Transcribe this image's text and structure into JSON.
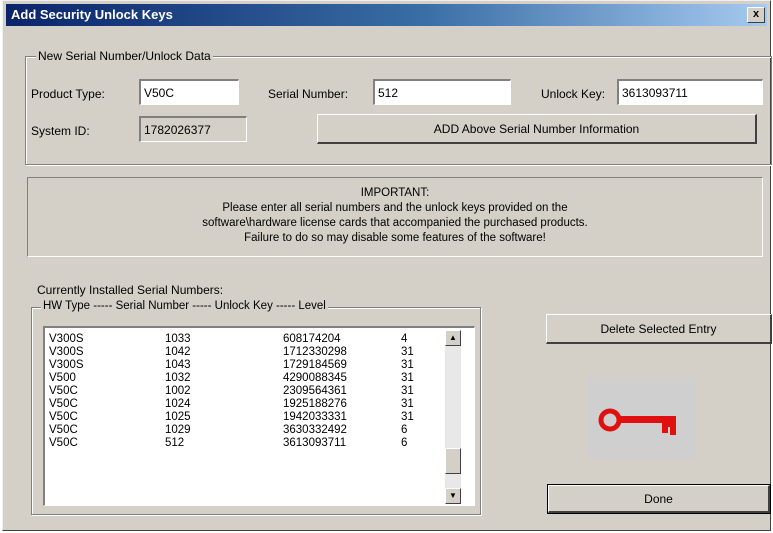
{
  "window": {
    "title": "Add Security Unlock Keys",
    "close_glyph": "x"
  },
  "serial_group": {
    "legend": "New Serial Number/Unlock Data",
    "product_type_label": "Product Type:",
    "product_type_value": "V50C",
    "serial_number_label": "Serial Number:",
    "serial_number_value": "512",
    "unlock_key_label": "Unlock Key:",
    "unlock_key_value": "3613093711",
    "system_id_label": "System ID:",
    "system_id_value": "1782026377",
    "add_button_label": "ADD Above Serial Number Information"
  },
  "important": {
    "heading": "IMPORTANT:",
    "line1": "Please enter all serial numbers and the unlock keys provided on the",
    "line2": "software\\hardware license cards that accompanied the purchased products.",
    "line3": "Failure to do so may disable some features of the software!"
  },
  "installed": {
    "label": "Currently Installed Serial Numbers:",
    "header": "HW Type ----- Serial Number ----- Unlock Key ----- Level",
    "rows": [
      {
        "hw_type": "V300S",
        "serial": "1033",
        "key": "608174204",
        "level": "4"
      },
      {
        "hw_type": "V300S",
        "serial": "1042",
        "key": "1712330298",
        "level": "31"
      },
      {
        "hw_type": "V300S",
        "serial": "1043",
        "key": "1729184569",
        "level": "31"
      },
      {
        "hw_type": "V500",
        "serial": "1032",
        "key": "4290088345",
        "level": "31"
      },
      {
        "hw_type": "V50C",
        "serial": "1002",
        "key": "2309564361",
        "level": "31"
      },
      {
        "hw_type": "V50C",
        "serial": "1024",
        "key": "1925188276",
        "level": "31"
      },
      {
        "hw_type": "V50C",
        "serial": "1025",
        "key": "1942033331",
        "level": "31"
      },
      {
        "hw_type": "V50C",
        "serial": "1029",
        "key": "3630332492",
        "level": "6"
      },
      {
        "hw_type": "V50C",
        "serial": "512",
        "key": "3613093711",
        "level": "6"
      }
    ]
  },
  "buttons": {
    "delete_label": "Delete Selected Entry",
    "done_label": "Done"
  },
  "icons": {
    "scroll_up": "▲",
    "scroll_down": "▼",
    "key_icon": "key-icon"
  },
  "colors": {
    "key": "#e01010",
    "titlebar_start": "#0a246a",
    "titlebar_end": "#a6caf0"
  }
}
